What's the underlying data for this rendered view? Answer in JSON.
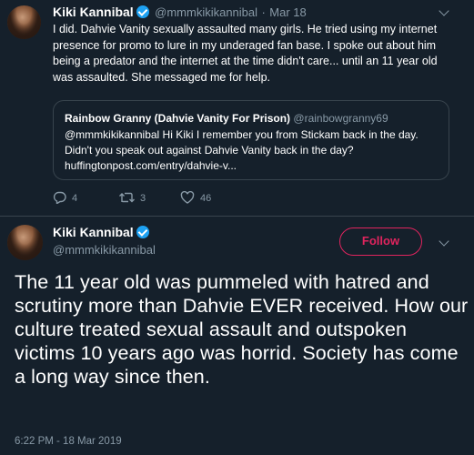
{
  "tweet1": {
    "name": "Kiki Kannibal",
    "handle": "@mmmkikikannibal",
    "separator": "·",
    "date": "Mar 18",
    "text": "I did. Dahvie Vanity sexually assaulted many girls. He tried using my internet presence for promo to lure in my underaged fan base. I spoke out about him being a predator and the internet at the time didn't care... until an 11 year old was assaulted. She messaged me for help.",
    "quote": {
      "name": "Rainbow Granny (Dahvie Vanity For Prison)",
      "handle": "@rainbowgranny69",
      "text": "@mmmkikikannibal Hi Kiki I remember you from Stickam back in the day. Didn't you speak out against Dahvie Vanity back in the day?",
      "link": "huffingtonpost.com/entry/dahvie-v..."
    },
    "actions": {
      "replies": "4",
      "retweets": "3",
      "likes": "46"
    }
  },
  "tweet2": {
    "name": "Kiki Kannibal",
    "handle": "@mmmkikikannibal",
    "follow_label": "Follow",
    "text": "The 11 year old was pummeled with hatred and scrutiny more than Dahvie EVER received. How our culture treated sexual assault and outspoken victims 10 years ago was horrid. Society has come a long way since then.",
    "timestamp": "6:22 PM - 18 Mar 2019"
  },
  "colors": {
    "background": "#15202b",
    "secondary_text": "#8899a6",
    "border": "#38444d",
    "verified": "#1da1f2",
    "follow_accent": "#e0245e"
  },
  "icons": [
    "reply-icon",
    "retweet-icon",
    "like-icon",
    "chevron-down-icon",
    "verified-badge-icon"
  ]
}
